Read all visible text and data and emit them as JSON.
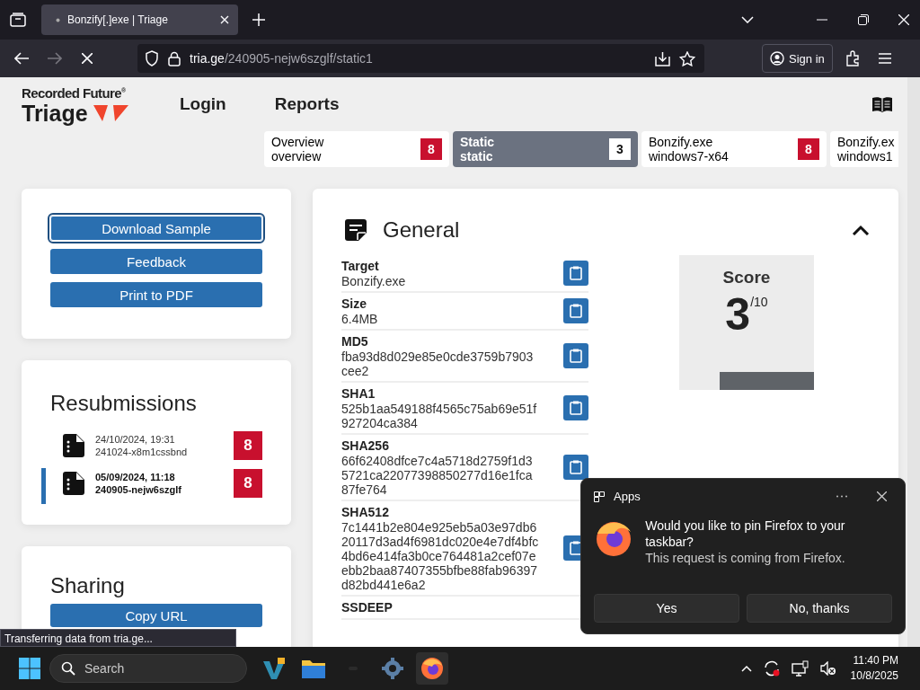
{
  "browser": {
    "tab_title": "Bonzify[.]exe | Triage",
    "url_host": "tria.ge",
    "url_path": "/240905-nejw6szglf/static1",
    "sign_in": "Sign in"
  },
  "site": {
    "brand_top": "Recorded Future$^{®}$",
    "brand": "Triage",
    "nav": [
      "Login",
      "Reports"
    ]
  },
  "report_tabs": [
    {
      "title": "Overview",
      "subtitle": "overview",
      "score": "8",
      "selected": false
    },
    {
      "title": "Static",
      "subtitle": "static",
      "score": "3",
      "selected": true
    },
    {
      "title": "Bonzify.exe",
      "subtitle": "windows7-x64",
      "score": "8",
      "selected": false
    },
    {
      "title": "Bonzify.ex",
      "subtitle": "windows1",
      "selected": false
    }
  ],
  "actions": [
    {
      "label": "Download Sample",
      "focused": true
    },
    {
      "label": "Feedback",
      "focused": false
    },
    {
      "label": "Print to PDF",
      "focused": false
    }
  ],
  "resubmissions": {
    "title": "Resubmissions",
    "items": [
      {
        "date": "24/10/2024, 19:31",
        "id": "241024-x8m1cssbnd",
        "score": "8",
        "selected": false
      },
      {
        "date": "05/09/2024, 11:18",
        "id": "240905-nejw6szglf",
        "score": "8",
        "selected": true
      }
    ]
  },
  "sharing": {
    "title": "Sharing",
    "buttons": [
      "Copy URL"
    ]
  },
  "general": {
    "title": "General",
    "fields": [
      {
        "label": "Target",
        "value": "Bonzify.exe"
      },
      {
        "label": "Size",
        "value": "6.4MB"
      },
      {
        "label": "MD5",
        "value": "fba93d8d029e85e0cde3759b7903cee2"
      },
      {
        "label": "SHA1",
        "value": "525b1aa549188f4565c75ab69e51f927204ca384"
      },
      {
        "label": "SHA256",
        "value": "66f62408dfce7c4a5718d2759f1d35721ca22077398850277d16e1fca87fe764"
      },
      {
        "label": "SHA512",
        "value": "7c1441b2e804e925eb5a03e97db620117d3ad4f6981dc020e4e7df4bfc4bd6e414fa3b0ce764481a2cef07eebb2baa87407355bfbe88fab96397d82bd441e6a2"
      },
      {
        "label": "SSDEEP"
      }
    ],
    "score": {
      "label": "Score",
      "value": "3",
      "max": "/10"
    }
  },
  "status_text": "Transferring data from tria.ge...",
  "notification": {
    "app": "Apps",
    "message": "Would you like to pin Firefox to your taskbar?",
    "detail": "This request is coming from Firefox.",
    "buttons": [
      "Yes",
      "No, thanks"
    ]
  },
  "taskbar": {
    "search_placeholder": "Search",
    "time": "11:40 PM",
    "date": "10/8/2025"
  }
}
